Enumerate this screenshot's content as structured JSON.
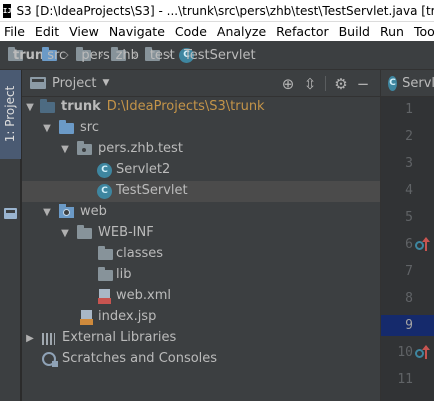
{
  "window": {
    "title": "S3 [D:\\IdeaProjects\\S3] - ...\\trunk\\src\\pers\\zhb\\test\\TestServlet.java [tru",
    "app_icon_text": "IJ"
  },
  "menu": {
    "items": [
      "File",
      "Edit",
      "View",
      "Navigate",
      "Code",
      "Analyze",
      "Refactor",
      "Build",
      "Run",
      "Tools"
    ]
  },
  "breadcrumb": {
    "items": [
      {
        "label": "trunk",
        "icon": "folder-icon"
      },
      {
        "label": "src",
        "icon": "folder-icon"
      },
      {
        "label": "pers",
        "icon": "folder-icon"
      },
      {
        "label": "zhb",
        "icon": "folder-icon"
      },
      {
        "label": "test",
        "icon": "folder-icon"
      },
      {
        "label": "TestServlet",
        "icon": "class-icon"
      }
    ]
  },
  "tool_strip": {
    "project_tab_label": "1: Project"
  },
  "project_panel": {
    "title": "Project",
    "header_icons": [
      "locate-icon",
      "collapse-icon",
      "gear-icon",
      "hide-icon"
    ],
    "tree": [
      {
        "label": "trunk",
        "path": "D:\\IdeaProjects\\S3\\trunk",
        "expanded": true,
        "icon": "module-folder-icon"
      },
      {
        "label": "src",
        "expanded": true,
        "icon": "source-folder-icon"
      },
      {
        "label": "pers.zhb.test",
        "expanded": true,
        "icon": "package-icon"
      },
      {
        "label": "Servlet2",
        "icon": "class-icon"
      },
      {
        "label": "TestServlet",
        "icon": "class-icon",
        "selected": true
      },
      {
        "label": "web",
        "expanded": true,
        "icon": "web-folder-icon"
      },
      {
        "label": "WEB-INF",
        "expanded": true,
        "icon": "folder-icon"
      },
      {
        "label": "classes",
        "icon": "folder-icon"
      },
      {
        "label": "lib",
        "icon": "folder-icon"
      },
      {
        "label": "web.xml",
        "icon": "xml-file-icon"
      },
      {
        "label": "index.jsp",
        "icon": "jsp-file-icon"
      },
      {
        "label": "External Libraries",
        "expanded": false,
        "icon": "libraries-icon"
      },
      {
        "label": "Scratches and Consoles",
        "icon": "scratches-icon"
      }
    ]
  },
  "editor": {
    "tab_label": "Servl",
    "line_numbers": [
      "1",
      "2",
      "3",
      "4",
      "5",
      "6",
      "7",
      "8",
      "9",
      "10",
      "11"
    ],
    "current_line": "9",
    "override_markers": [
      "6",
      "10"
    ]
  },
  "colors": {
    "selection": "#4b4b4b",
    "current_line": "#152a6c",
    "path_text": "#c49449",
    "panel_bg": "#3c3f41",
    "editor_bg": "#2b2b2b"
  }
}
